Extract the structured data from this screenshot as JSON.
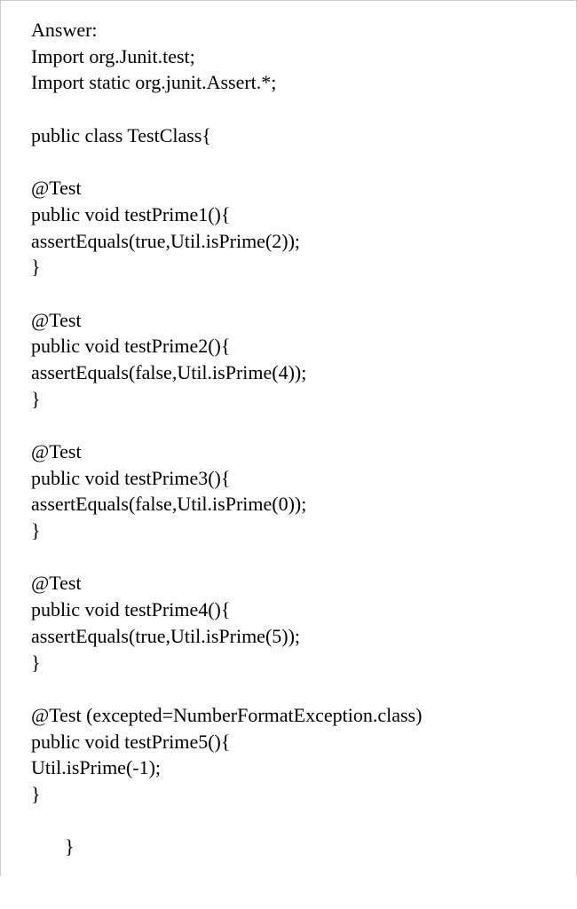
{
  "lines": {
    "l1": "Answer:",
    "l2": "Import org.Junit.test;",
    "l3": "Import static org.junit.Assert.*;",
    "l4": "public class TestClass{",
    "l5": "@Test",
    "l6": "public void testPrime1(){",
    "l7": "assertEquals(true,Util.isPrime(2));",
    "l8": "}",
    "l9": "@Test",
    "l10": "public void testPrime2(){",
    "l11": "assertEquals(false,Util.isPrime(4));",
    "l12": "}",
    "l13": "@Test",
    "l14": "public void testPrime3(){",
    "l15": "assertEquals(false,Util.isPrime(0));",
    "l16": "}",
    "l17": "@Test",
    "l18": "public void testPrime4(){",
    "l19": "assertEquals(true,Util.isPrime(5));",
    "l20": "}",
    "l21": "@Test (excepted=NumberFormatException.class)",
    "l22": "public void testPrime5(){",
    "l23": "Util.isPrime(-1);",
    "l24": "}",
    "l25": "}"
  }
}
